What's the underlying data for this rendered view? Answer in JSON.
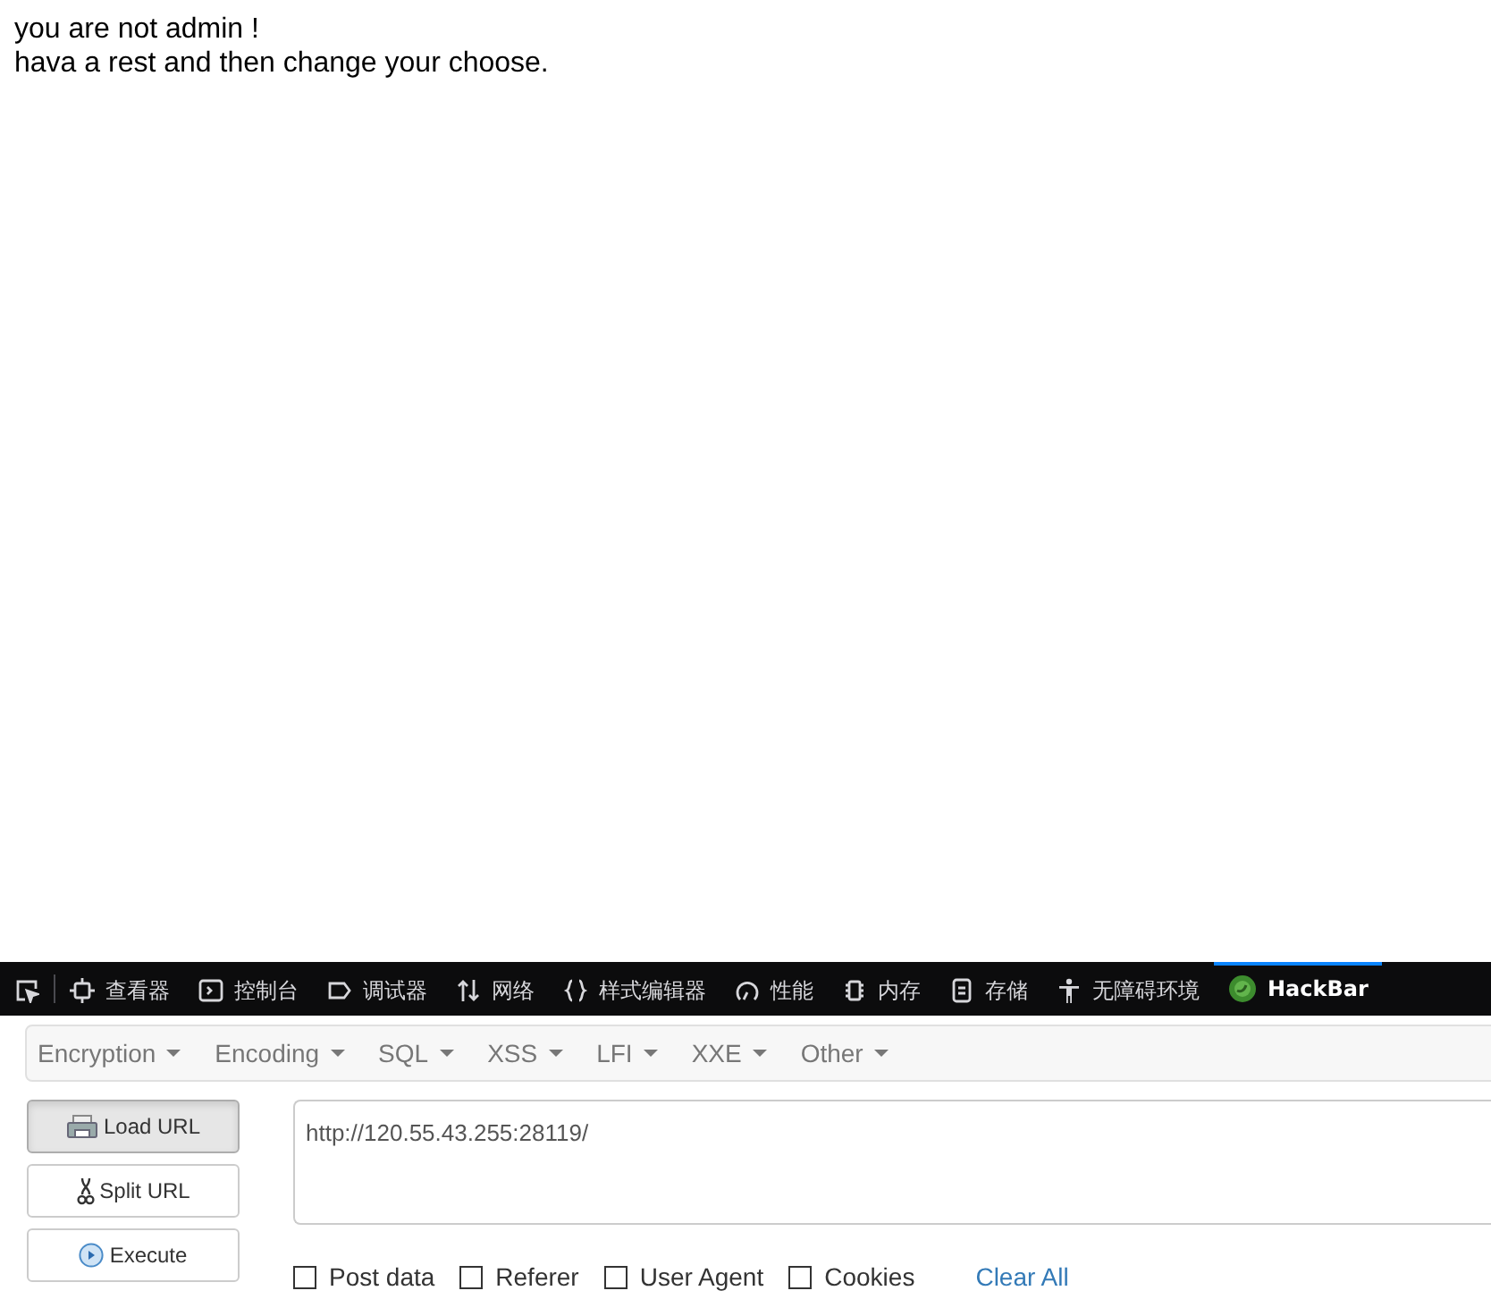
{
  "page": {
    "lines": [
      "you are not admin !",
      "hava a rest and then change your choose."
    ]
  },
  "devtools": {
    "tabs": [
      {
        "kind": "picker",
        "selected": false
      },
      {
        "kind": "inspector",
        "label": "查看器",
        "selected": false
      },
      {
        "kind": "console",
        "label": "控制台",
        "selected": false
      },
      {
        "kind": "debugger",
        "label": "调试器",
        "selected": false
      },
      {
        "kind": "network",
        "label": "网络",
        "selected": false
      },
      {
        "kind": "style",
        "label": "样式编辑器",
        "selected": false
      },
      {
        "kind": "performance",
        "label": "性能",
        "selected": false
      },
      {
        "kind": "memory",
        "label": "内存",
        "selected": false
      },
      {
        "kind": "storage",
        "label": "存储",
        "selected": false
      },
      {
        "kind": "accessibility",
        "label": "无障碍环境",
        "selected": false
      },
      {
        "kind": "hackbar",
        "label": "HackBar",
        "selected": true
      }
    ]
  },
  "hackbar": {
    "menus": [
      "Encryption",
      "Encoding",
      "SQL",
      "XSS",
      "LFI",
      "XXE",
      "Other"
    ],
    "buttons": [
      {
        "kind": "load",
        "label": "Load URL",
        "pressed": true
      },
      {
        "kind": "split",
        "label": "Split URL",
        "pressed": false
      },
      {
        "kind": "execute",
        "label": "Execute",
        "pressed": false
      }
    ],
    "url": "http://120.55.43.255:28119/",
    "options": [
      {
        "label": "Post data",
        "checked": false
      },
      {
        "label": "Referer",
        "checked": false
      },
      {
        "label": "User Agent",
        "checked": false
      },
      {
        "label": "Cookies",
        "checked": false
      }
    ],
    "clear": "Clear All"
  }
}
